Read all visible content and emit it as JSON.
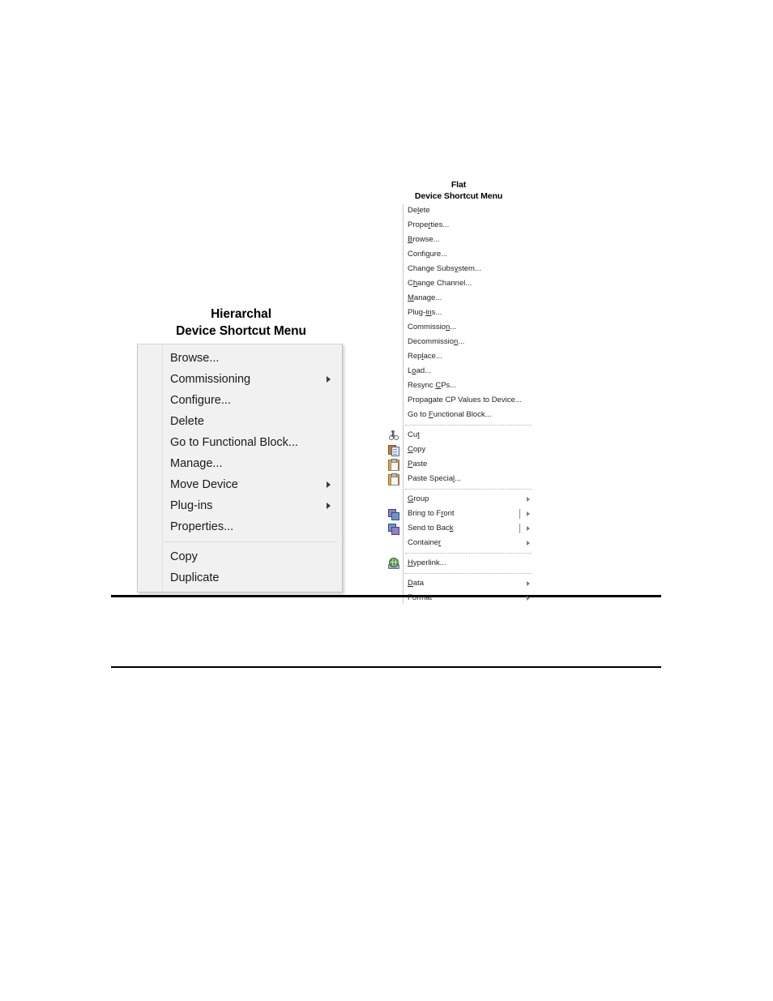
{
  "figure": {
    "hierarchical_caption": {
      "line1": "Hierarchal",
      "line2": "Device Shortcut Menu"
    },
    "flat_caption": {
      "line1": "Flat",
      "line2": "Device Shortcut Menu"
    }
  },
  "hierarchical_menu": {
    "items": [
      {
        "label": "Browse...",
        "submenu": false
      },
      {
        "label": "Commissioning",
        "submenu": true
      },
      {
        "label": "Configure...",
        "submenu": false
      },
      {
        "label": "Delete",
        "submenu": false
      },
      {
        "label": "Go to Functional Block...",
        "submenu": false
      },
      {
        "label": "Manage...",
        "submenu": false
      },
      {
        "label": "Move Device",
        "submenu": true
      },
      {
        "label": "Plug-ins",
        "submenu": true
      },
      {
        "label": "Properties...",
        "submenu": false
      },
      {
        "separator": true
      },
      {
        "label": "Copy",
        "submenu": false
      },
      {
        "label": "Duplicate",
        "submenu": false
      }
    ]
  },
  "flat_menu": {
    "items": [
      {
        "pre": "De",
        "mnemonic": "l",
        "post": "ete",
        "icon": null,
        "submenu": false,
        "bar": false
      },
      {
        "pre": "Prope",
        "mnemonic": "r",
        "post": "ties...",
        "icon": null,
        "submenu": false,
        "bar": false
      },
      {
        "pre": "",
        "mnemonic": "B",
        "post": "rowse...",
        "icon": null,
        "submenu": false,
        "bar": false
      },
      {
        "pre": "Confi",
        "mnemonic": "g",
        "post": "ure...",
        "icon": null,
        "submenu": false,
        "bar": false
      },
      {
        "pre": "Change Subs",
        "mnemonic": "y",
        "post": "stem...",
        "icon": null,
        "submenu": false,
        "bar": false
      },
      {
        "pre": "C",
        "mnemonic": "h",
        "post": "ange Channel...",
        "icon": null,
        "submenu": false,
        "bar": false
      },
      {
        "pre": "",
        "mnemonic": "M",
        "post": "anage...",
        "icon": null,
        "submenu": false,
        "bar": false
      },
      {
        "pre": "Plug-",
        "mnemonic": "in",
        "post": "s...",
        "icon": null,
        "submenu": false,
        "bar": false
      },
      {
        "pre": "Commissio",
        "mnemonic": "n",
        "post": "...",
        "icon": null,
        "submenu": false,
        "bar": false
      },
      {
        "pre": "Decommissio",
        "mnemonic": "n",
        "post": "...",
        "icon": null,
        "submenu": false,
        "bar": false
      },
      {
        "pre": "Rep",
        "mnemonic": "l",
        "post": "ace...",
        "icon": null,
        "submenu": false,
        "bar": false
      },
      {
        "pre": "L",
        "mnemonic": "o",
        "post": "ad...",
        "icon": null,
        "submenu": false,
        "bar": false
      },
      {
        "pre": "Resync ",
        "mnemonic": "C",
        "post": "Ps...",
        "icon": null,
        "submenu": false,
        "bar": false
      },
      {
        "pre": "Propagate CP Values to Device...",
        "mnemonic": "",
        "post": "",
        "icon": null,
        "submenu": false,
        "bar": false
      },
      {
        "pre": "Go to ",
        "mnemonic": "F",
        "post": "unctional Block...",
        "icon": null,
        "submenu": false,
        "bar": false
      },
      {
        "separator": true
      },
      {
        "pre": "Cu",
        "mnemonic": "t",
        "post": "",
        "icon": "cut-icon",
        "submenu": false,
        "bar": false
      },
      {
        "pre": "",
        "mnemonic": "C",
        "post": "opy",
        "icon": "copy-icon",
        "submenu": false,
        "bar": false
      },
      {
        "pre": "",
        "mnemonic": "P",
        "post": "aste",
        "icon": "paste-icon",
        "submenu": false,
        "bar": false
      },
      {
        "pre": "Paste Specia",
        "mnemonic": "l",
        "post": "...",
        "icon": "paste-special-icon",
        "submenu": false,
        "bar": false
      },
      {
        "separator": true
      },
      {
        "pre": "",
        "mnemonic": "G",
        "post": "roup",
        "icon": null,
        "submenu": true,
        "bar": false
      },
      {
        "pre": "Bring to F",
        "mnemonic": "r",
        "post": "ont",
        "icon": "bring-to-front-icon",
        "submenu": true,
        "bar": true
      },
      {
        "pre": "Send to Bac",
        "mnemonic": "k",
        "post": "",
        "icon": "send-to-back-icon",
        "submenu": true,
        "bar": true
      },
      {
        "pre": "Containe",
        "mnemonic": "r",
        "post": "",
        "icon": null,
        "submenu": true,
        "bar": false
      },
      {
        "separator": true
      },
      {
        "pre": "",
        "mnemonic": "H",
        "post": "yperlink...",
        "icon": "hyperlink-icon",
        "submenu": false,
        "bar": false
      },
      {
        "separator": true
      },
      {
        "pre": "",
        "mnemonic": "D",
        "post": "ata",
        "icon": null,
        "submenu": true,
        "bar": false
      },
      {
        "pre": "Format",
        "mnemonic": "",
        "post": "",
        "icon": null,
        "submenu": true,
        "bar": false
      }
    ]
  },
  "colors": {
    "menu_background_hierarchical": "#f1f1f1",
    "menu_background_flat": "#ffffff",
    "menu_border": "#c6c6c6",
    "text": "#1a1a1a",
    "separator": "#dcdcdc",
    "rule": "#000000"
  }
}
